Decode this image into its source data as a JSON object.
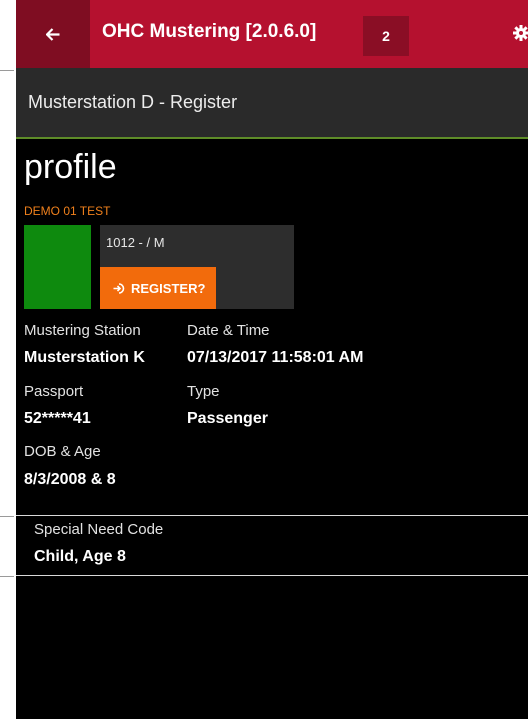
{
  "header": {
    "back_icon": "arrow-left-icon",
    "title": "OHC Mustering [2.0.6.0]",
    "badge": "2",
    "settings_icon": "gear-icon"
  },
  "subheader": {
    "text": "Musterstation D - Register"
  },
  "profile": {
    "title": "profile",
    "name": "DEMO 01 TEST",
    "id_text": "1012 -  / M",
    "register_label": "REGISTER?",
    "register_icon": "sign-in-icon",
    "status_color": "#0e8a0e"
  },
  "details": {
    "mustering_station_label": "Mustering Station",
    "mustering_station_value": "Musterstation K",
    "datetime_label": "Date & Time",
    "datetime_value": "07/13/2017 11:58:01 AM",
    "passport_label": "Passport",
    "passport_value": "52*****41",
    "type_label": "Type",
    "type_value": "Passenger",
    "dob_label": "DOB & Age",
    "dob_value": "8/3/2008 & 8"
  },
  "special_need": {
    "label": "Special Need Code",
    "value": "Child, Age 8"
  },
  "colors": {
    "header": "#b5112f",
    "header_dark": "#7f0d22",
    "accent_orange": "#f26b0c",
    "subheader_border": "#5e8c28"
  }
}
